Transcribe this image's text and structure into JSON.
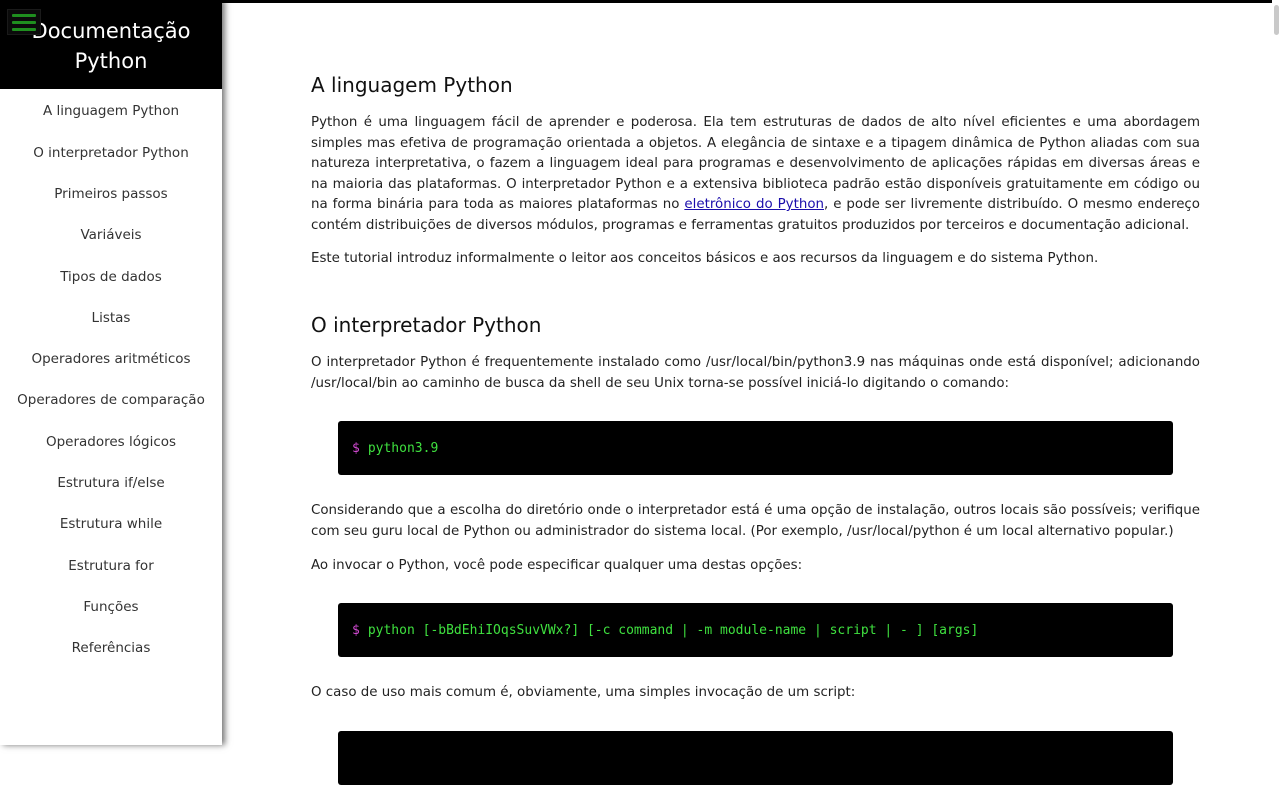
{
  "sidebar": {
    "title": "Documentação Python",
    "menu_icon": "hamburger-icon",
    "items": [
      "A linguagem Python",
      "O interpretador Python",
      "Primeiros passos",
      "Variáveis",
      "Tipos de dados",
      "Listas",
      "Operadores aritméticos",
      "Operadores de comparação",
      "Operadores lógicos",
      "Estrutura if/else",
      "Estrutura while",
      "Estrutura for",
      "Funções",
      "Referências"
    ]
  },
  "section1": {
    "title": "A linguagem Python",
    "p1_before_link": "Python é uma linguagem fácil de aprender e poderosa. Ela tem estruturas de dados de alto nível eficientes e uma abordagem simples mas efetiva de programação orientada a objetos. A elegância de sintaxe e a tipagem dinâmica de Python aliadas com sua natureza interpretativa, o fazem a linguagem ideal para programas e desenvolvimento de aplicações rápidas em diversas áreas e na maioria das plataformas. O interpretador Python e a extensiva biblioteca padrão estão disponíveis gratuitamente em código ou na forma binária para toda as maiores plataformas no ",
    "p1_link": "eletrônico do Python",
    "p1_after_link": ", e pode ser livremente distribuído. O mesmo endereço contém distribuições de diversos módulos, programas e ferramentas gratuitos produzidos por terceiros e documentação adicional.",
    "p2": "Este tutorial introduz informalmente o leitor aos conceitos básicos e aos recursos da linguagem e do sistema Python."
  },
  "section2": {
    "title": "O interpretador Python",
    "p1": "O interpretador Python é frequentemente instalado como /usr/local/bin/python3.9 nas máquinas onde está disponível; adicionando /usr/local/bin ao caminho de busca da shell de seu Unix torna-se possível iniciá-lo digitando o comando:",
    "code1_prompt": "$",
    "code1": "python3.9",
    "p2": "Considerando que a escolha do diretório onde o interpretador está é uma opção de instalação, outros locais são possíveis; verifique com seu guru local de Python ou administrador do sistema local. (Por exemplo, /usr/local/python é um local alternativo popular.)",
    "p3": "Ao invocar o Python, você pode especificar qualquer uma destas opções:",
    "code2_prompt": "$",
    "code2": "python [-bBdEhiIOqsSuvVWx?] [-c command | -m module-name | script | - ] [args]",
    "p4": "O caso de uso mais comum é, obviamente, uma simples invocação de um script:"
  },
  "colors": {
    "header_bg": "#000000",
    "code_bg": "#000000",
    "code_text": "#3fe03f",
    "prompt": "#d24ad2",
    "link": "#1a0dab",
    "menu_icon": "#1f8f1f"
  }
}
